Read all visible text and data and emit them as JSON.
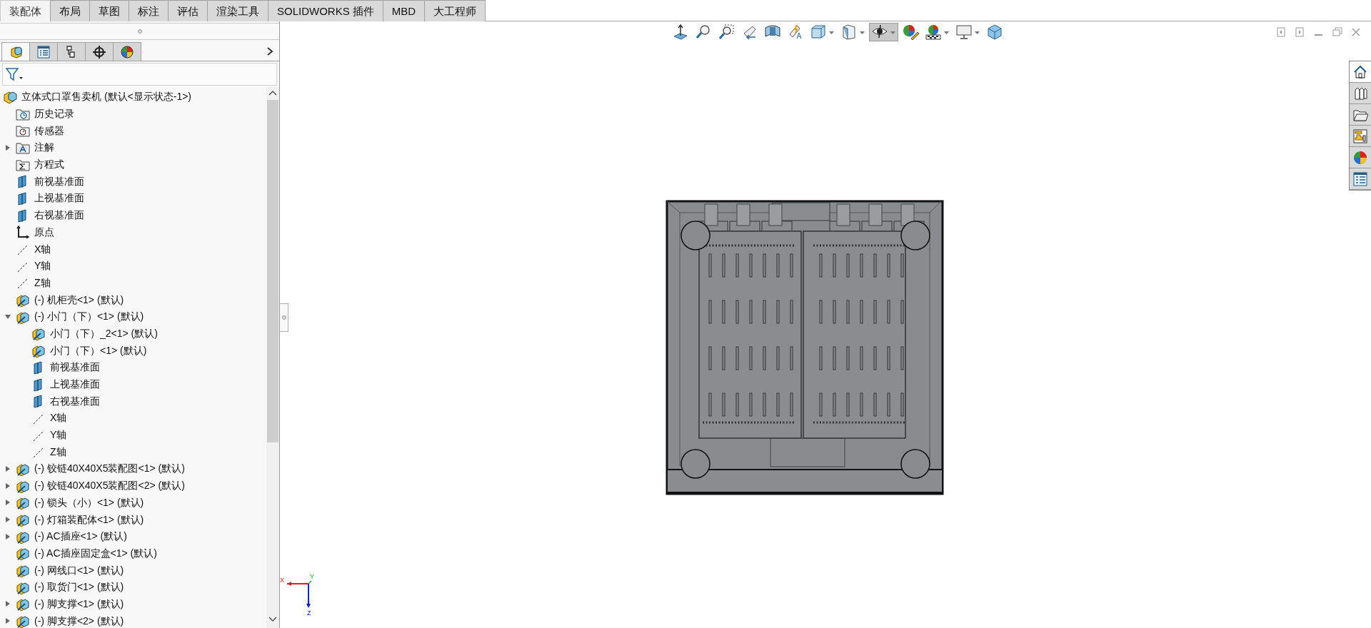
{
  "ribbon_tabs": [
    {
      "label": "装配体",
      "selected": true
    },
    {
      "label": "布局",
      "selected": false
    },
    {
      "label": "草图",
      "selected": false
    },
    {
      "label": "标注",
      "selected": false
    },
    {
      "label": "评估",
      "selected": false
    },
    {
      "label": "渲染工具",
      "selected": false
    },
    {
      "label": "SOLIDWORKS 插件",
      "selected": false
    },
    {
      "label": "MBD",
      "selected": false
    },
    {
      "label": "大工程师",
      "selected": false
    }
  ],
  "view_toolbar": [
    {
      "dropdown": false,
      "pressed": false
    },
    {
      "dropdown": false,
      "pressed": false
    },
    {
      "dropdown": false,
      "pressed": false
    },
    {
      "dropdown": false,
      "pressed": false
    },
    {
      "dropdown": false,
      "pressed": false
    },
    {
      "dropdown": false,
      "pressed": false
    },
    {
      "dropdown": true,
      "pressed": false
    },
    {
      "dropdown": true,
      "pressed": false
    },
    {
      "dropdown": true,
      "pressed": true
    },
    {
      "dropdown": false,
      "pressed": false
    },
    {
      "dropdown": true,
      "pressed": false
    },
    {
      "dropdown": true,
      "pressed": false
    },
    {
      "dropdown": false,
      "pressed": false
    }
  ],
  "panel_tabs": [
    {
      "selected": true
    },
    {
      "selected": false
    },
    {
      "selected": false
    },
    {
      "selected": false
    },
    {
      "selected": false
    }
  ],
  "feature_tree": [
    {
      "kind": "assembly",
      "label": "立体式口罩售卖机 (默认<显示状态-1>)",
      "children": [
        {
          "kind": "history",
          "label": "历史记录"
        },
        {
          "kind": "sensor",
          "label": "传感器"
        },
        {
          "kind": "annotation",
          "label": "注解",
          "expanded": false
        },
        {
          "kind": "equation",
          "label": "方程式"
        },
        {
          "kind": "plane",
          "label": "前视基准面"
        },
        {
          "kind": "plane",
          "label": "上视基准面"
        },
        {
          "kind": "plane",
          "label": "右视基准面"
        },
        {
          "kind": "origin",
          "label": "原点"
        },
        {
          "kind": "axis",
          "label": "X轴"
        },
        {
          "kind": "axis",
          "label": "Y轴"
        },
        {
          "kind": "axis",
          "label": "Z轴"
        },
        {
          "kind": "component",
          "label": "(-) 机柜壳<1> (默认)"
        },
        {
          "kind": "component",
          "label": "(-) 小门（下）<1> (默认)",
          "expanded": true,
          "children": [
            {
              "kind": "component",
              "label": "小门（下）_2<1> (默认)"
            },
            {
              "kind": "component",
              "label": "小门（下）<1> (默认)"
            },
            {
              "kind": "plane",
              "label": "前视基准面"
            },
            {
              "kind": "plane",
              "label": "上视基准面"
            },
            {
              "kind": "plane",
              "label": "右视基准面"
            },
            {
              "kind": "axis",
              "label": "X轴"
            },
            {
              "kind": "axis",
              "label": "Y轴"
            },
            {
              "kind": "axis",
              "label": "Z轴"
            }
          ]
        },
        {
          "kind": "component",
          "label": "(-) 铰链40X40X5装配图<1> (默认)",
          "expanded": false
        },
        {
          "kind": "component",
          "label": "(-) 铰链40X40X5装配图<2> (默认)",
          "expanded": false
        },
        {
          "kind": "component",
          "label": "(-) 锁头（小）<1> (默认)",
          "expanded": false
        },
        {
          "kind": "component",
          "label": "(-) 灯箱装配体<1> (默认)",
          "expanded": false
        },
        {
          "kind": "component",
          "label": "(-) AC插座<1> (默认)",
          "expanded": false
        },
        {
          "kind": "component",
          "label": "(-) AC插座固定盒<1> (默认)"
        },
        {
          "kind": "component",
          "label": "(-) 网线口<1> (默认)"
        },
        {
          "kind": "component",
          "label": "(-) 取货门<1> (默认)"
        },
        {
          "kind": "component",
          "label": "(-) 脚支撑<1> (默认)",
          "expanded": false
        },
        {
          "kind": "component",
          "label": "(-) 脚支撑<2> (默认)",
          "expanded": false
        }
      ]
    }
  ],
  "triad": {
    "x_label": "X",
    "y_label": "Y",
    "z_label": "Z"
  },
  "task_pane_tabs": [
    {
      "selected": true
    },
    {
      "selected": false
    },
    {
      "selected": false
    },
    {
      "selected": false
    },
    {
      "selected": false
    },
    {
      "selected": false
    }
  ]
}
